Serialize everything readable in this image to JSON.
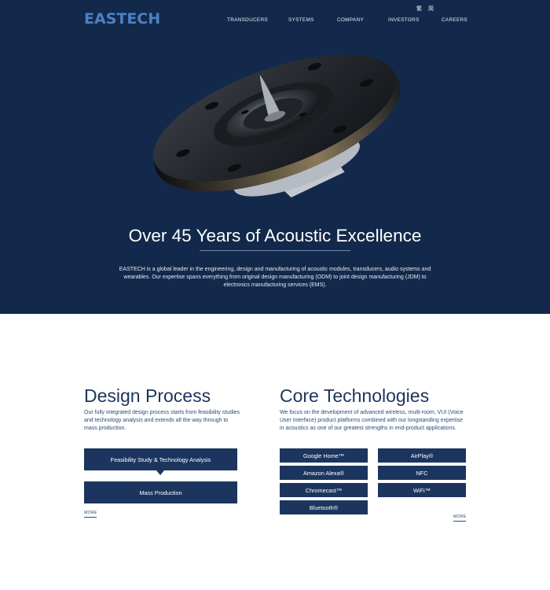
{
  "header": {
    "logo": "EASTECH",
    "lang": [
      "繁",
      "简"
    ],
    "nav": [
      "TRANSDUCERS",
      "SYSTEMS",
      "COMPANY",
      "INVESTORS",
      "CAREERS"
    ]
  },
  "hero": {
    "title": "Over 45 Years of Acoustic Excellence",
    "intro": "EASTECH is a global leader in the engineering, design and manufacturing of acoustic modules, transducers, audio systems and wearables. Our expertise spans everything from original design manufacturing (ODM) to joint design manufacturing (JDM) to electronics manufacturing services (EMS)."
  },
  "design": {
    "title": "Design Process",
    "text": "Our fully integrated design process starts from feasibility studies and technology analysis and extends all the way through to mass production.",
    "steps": [
      "Feasibility Study & Technology Analysis",
      "Mass Production"
    ],
    "more": "MORE"
  },
  "core": {
    "title": "Core Technologies",
    "text": "We focus on the development of advanced wireless, multi-room, VUI (Voice User Interface) product platforms combined with our longstanding expertise in acoustics as one of our greatest strengths in end-product applications.",
    "tech": [
      "Google Home™",
      "AirPlay®",
      "Amazon Alexa®",
      "NFC",
      "Chromecast™",
      "WiFi™",
      "Bluetooth®"
    ],
    "more": "MORE"
  },
  "colors": {
    "navy": "#13294b",
    "button": "#1b355e",
    "logo": "#4a82c4"
  }
}
